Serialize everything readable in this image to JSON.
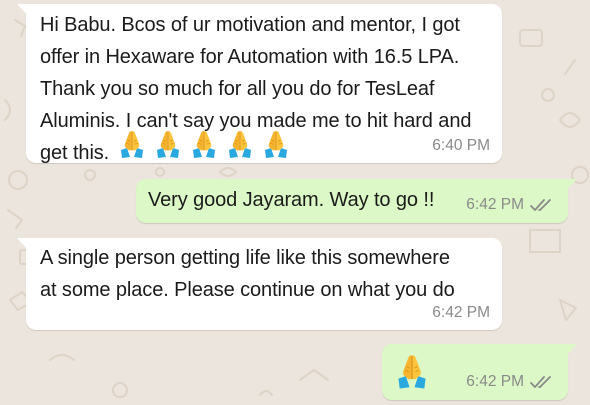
{
  "messages": [
    {
      "direction": "incoming",
      "text": "Hi Babu. Bcos of ur motivation and mentor, I got\noffer in Hexaware for Automation with 16.5 LPA.\nThank you so much for all you do for TesLeaf\nAluminis. I can't say you made me to hit hard and\nget this.",
      "emoji": [
        "folded-hands",
        "folded-hands",
        "folded-hands",
        "folded-hands",
        "folded-hands"
      ],
      "time": "6:40 PM"
    },
    {
      "direction": "outgoing",
      "text": "Very good Jayaram. Way to go !!",
      "time": "6:42 PM",
      "status_icon": "double-check-icon"
    },
    {
      "direction": "incoming",
      "text": "A single person getting life like this somewhere\nat some place. Please continue on what you do",
      "time": "6:42 PM"
    },
    {
      "direction": "outgoing",
      "emoji": [
        "folded-hands"
      ],
      "time": "6:42 PM",
      "status_icon": "double-check-icon"
    }
  ],
  "colors": {
    "incoming_bubble": "#ffffff",
    "outgoing_bubble": "#dcf8c6",
    "wallpaper": "#ece5dd",
    "timestamp": "#8a8a8a",
    "text": "#1b1b1b"
  }
}
